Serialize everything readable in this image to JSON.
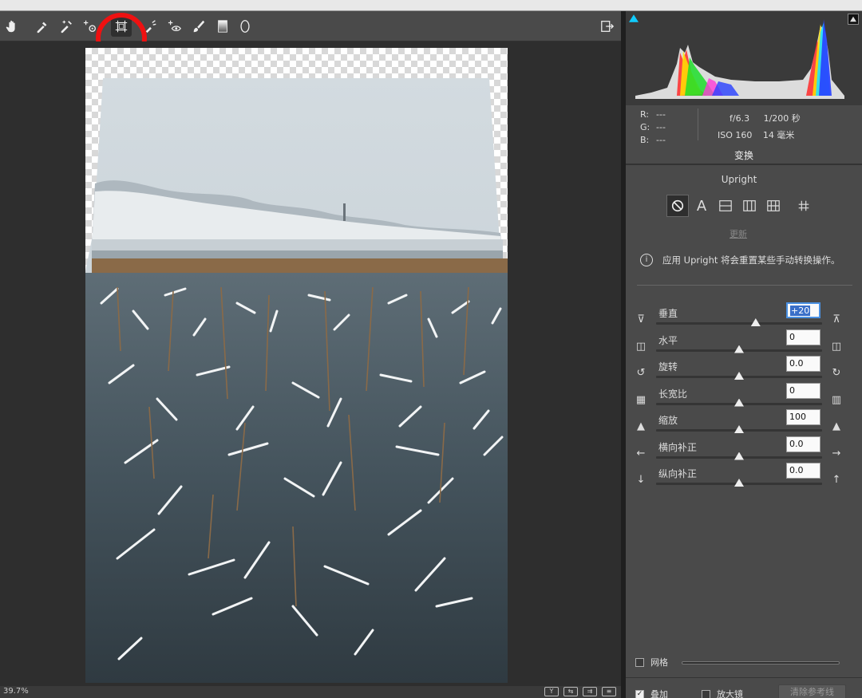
{
  "toolbar": {
    "tools": [
      "hand-icon",
      "white-balance-icon",
      "color-sampler-icon",
      "targeted-adjust-icon",
      "transform-icon",
      "spot-removal-icon",
      "red-eye-icon",
      "adjustment-brush-icon",
      "graduated-filter-icon",
      "radial-filter-icon"
    ],
    "active_tool": "transform-icon",
    "export_icon": "export-icon"
  },
  "canvas": {
    "preview_desc_colors": {
      "sky": "#cfd7dc",
      "water": "#3e4a52",
      "reeds": "#8a6a48"
    }
  },
  "status": {
    "zoom": "39.7%"
  },
  "histogram": {
    "shadow_clip_color": "#11ccff"
  },
  "info": {
    "r_label": "R:",
    "g_label": "G:",
    "b_label": "B:",
    "r_val": "---",
    "g_val": "---",
    "b_val": "---",
    "aperture": "f/6.3",
    "shutter": "1/200 秒",
    "iso": "ISO 160",
    "focal": "14 毫米"
  },
  "transform": {
    "title": "变换",
    "upright_label": "Upright",
    "update_label": "更新",
    "note": "应用 Upright 将会重置某些手动转换操作。",
    "sliders": [
      {
        "label": "垂直",
        "value": "+20",
        "position": 0.6,
        "focused": true
      },
      {
        "label": "水平",
        "value": "0",
        "position": 0.5
      },
      {
        "label": "旋转",
        "value": "0.0",
        "position": 0.5
      },
      {
        "label": "长宽比",
        "value": "0",
        "position": 0.5
      },
      {
        "label": "缩放",
        "value": "100",
        "position": 0.5
      },
      {
        "label": "横向补正",
        "value": "0.0",
        "position": 0.5
      },
      {
        "label": "纵向补正",
        "value": "0.0",
        "position": 0.5
      }
    ],
    "grid_label": "网格",
    "overlay_label": "叠加",
    "loupe_label": "放大镜",
    "clear_guides_label": "清除参考线"
  }
}
